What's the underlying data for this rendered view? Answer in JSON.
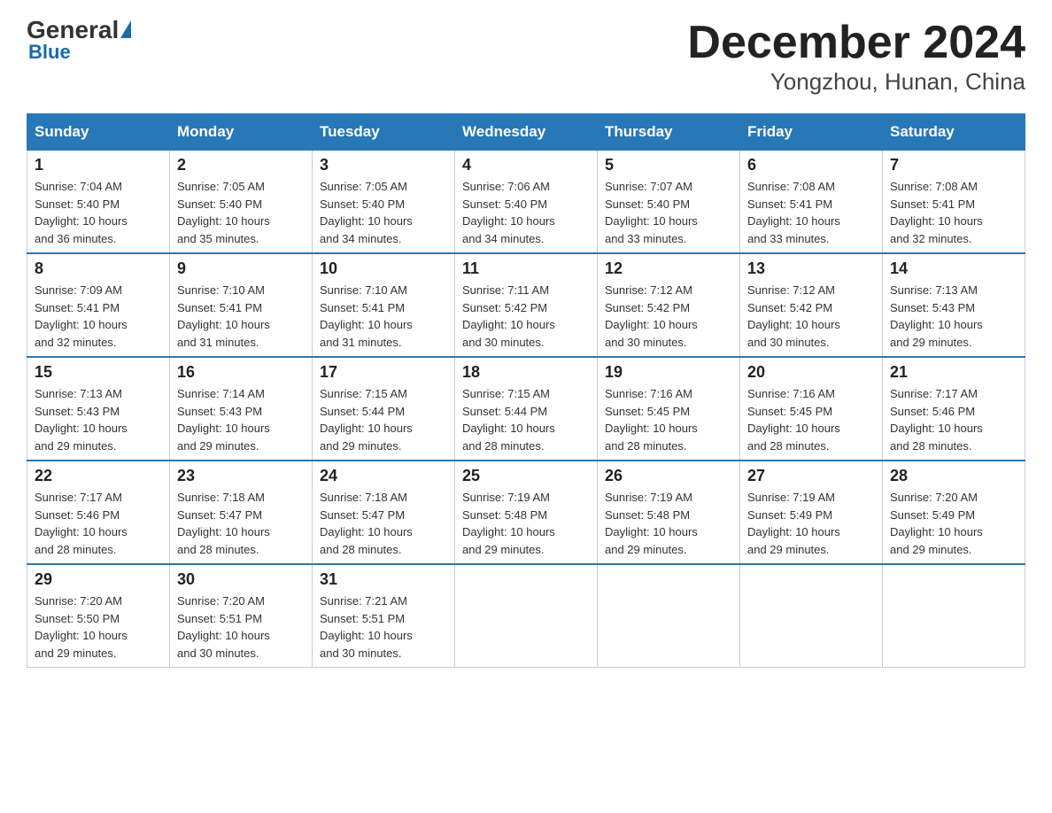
{
  "logo": {
    "general": "General",
    "blue": "Blue"
  },
  "title": "December 2024",
  "subtitle": "Yongzhou, Hunan, China",
  "headers": [
    "Sunday",
    "Monday",
    "Tuesday",
    "Wednesday",
    "Thursday",
    "Friday",
    "Saturday"
  ],
  "weeks": [
    [
      {
        "day": "1",
        "info": "Sunrise: 7:04 AM\nSunset: 5:40 PM\nDaylight: 10 hours\nand 36 minutes."
      },
      {
        "day": "2",
        "info": "Sunrise: 7:05 AM\nSunset: 5:40 PM\nDaylight: 10 hours\nand 35 minutes."
      },
      {
        "day": "3",
        "info": "Sunrise: 7:05 AM\nSunset: 5:40 PM\nDaylight: 10 hours\nand 34 minutes."
      },
      {
        "day": "4",
        "info": "Sunrise: 7:06 AM\nSunset: 5:40 PM\nDaylight: 10 hours\nand 34 minutes."
      },
      {
        "day": "5",
        "info": "Sunrise: 7:07 AM\nSunset: 5:40 PM\nDaylight: 10 hours\nand 33 minutes."
      },
      {
        "day": "6",
        "info": "Sunrise: 7:08 AM\nSunset: 5:41 PM\nDaylight: 10 hours\nand 33 minutes."
      },
      {
        "day": "7",
        "info": "Sunrise: 7:08 AM\nSunset: 5:41 PM\nDaylight: 10 hours\nand 32 minutes."
      }
    ],
    [
      {
        "day": "8",
        "info": "Sunrise: 7:09 AM\nSunset: 5:41 PM\nDaylight: 10 hours\nand 32 minutes."
      },
      {
        "day": "9",
        "info": "Sunrise: 7:10 AM\nSunset: 5:41 PM\nDaylight: 10 hours\nand 31 minutes."
      },
      {
        "day": "10",
        "info": "Sunrise: 7:10 AM\nSunset: 5:41 PM\nDaylight: 10 hours\nand 31 minutes."
      },
      {
        "day": "11",
        "info": "Sunrise: 7:11 AM\nSunset: 5:42 PM\nDaylight: 10 hours\nand 30 minutes."
      },
      {
        "day": "12",
        "info": "Sunrise: 7:12 AM\nSunset: 5:42 PM\nDaylight: 10 hours\nand 30 minutes."
      },
      {
        "day": "13",
        "info": "Sunrise: 7:12 AM\nSunset: 5:42 PM\nDaylight: 10 hours\nand 30 minutes."
      },
      {
        "day": "14",
        "info": "Sunrise: 7:13 AM\nSunset: 5:43 PM\nDaylight: 10 hours\nand 29 minutes."
      }
    ],
    [
      {
        "day": "15",
        "info": "Sunrise: 7:13 AM\nSunset: 5:43 PM\nDaylight: 10 hours\nand 29 minutes."
      },
      {
        "day": "16",
        "info": "Sunrise: 7:14 AM\nSunset: 5:43 PM\nDaylight: 10 hours\nand 29 minutes."
      },
      {
        "day": "17",
        "info": "Sunrise: 7:15 AM\nSunset: 5:44 PM\nDaylight: 10 hours\nand 29 minutes."
      },
      {
        "day": "18",
        "info": "Sunrise: 7:15 AM\nSunset: 5:44 PM\nDaylight: 10 hours\nand 28 minutes."
      },
      {
        "day": "19",
        "info": "Sunrise: 7:16 AM\nSunset: 5:45 PM\nDaylight: 10 hours\nand 28 minutes."
      },
      {
        "day": "20",
        "info": "Sunrise: 7:16 AM\nSunset: 5:45 PM\nDaylight: 10 hours\nand 28 minutes."
      },
      {
        "day": "21",
        "info": "Sunrise: 7:17 AM\nSunset: 5:46 PM\nDaylight: 10 hours\nand 28 minutes."
      }
    ],
    [
      {
        "day": "22",
        "info": "Sunrise: 7:17 AM\nSunset: 5:46 PM\nDaylight: 10 hours\nand 28 minutes."
      },
      {
        "day": "23",
        "info": "Sunrise: 7:18 AM\nSunset: 5:47 PM\nDaylight: 10 hours\nand 28 minutes."
      },
      {
        "day": "24",
        "info": "Sunrise: 7:18 AM\nSunset: 5:47 PM\nDaylight: 10 hours\nand 28 minutes."
      },
      {
        "day": "25",
        "info": "Sunrise: 7:19 AM\nSunset: 5:48 PM\nDaylight: 10 hours\nand 29 minutes."
      },
      {
        "day": "26",
        "info": "Sunrise: 7:19 AM\nSunset: 5:48 PM\nDaylight: 10 hours\nand 29 minutes."
      },
      {
        "day": "27",
        "info": "Sunrise: 7:19 AM\nSunset: 5:49 PM\nDaylight: 10 hours\nand 29 minutes."
      },
      {
        "day": "28",
        "info": "Sunrise: 7:20 AM\nSunset: 5:49 PM\nDaylight: 10 hours\nand 29 minutes."
      }
    ],
    [
      {
        "day": "29",
        "info": "Sunrise: 7:20 AM\nSunset: 5:50 PM\nDaylight: 10 hours\nand 29 minutes."
      },
      {
        "day": "30",
        "info": "Sunrise: 7:20 AM\nSunset: 5:51 PM\nDaylight: 10 hours\nand 30 minutes."
      },
      {
        "day": "31",
        "info": "Sunrise: 7:21 AM\nSunset: 5:51 PM\nDaylight: 10 hours\nand 30 minutes."
      },
      null,
      null,
      null,
      null
    ]
  ]
}
